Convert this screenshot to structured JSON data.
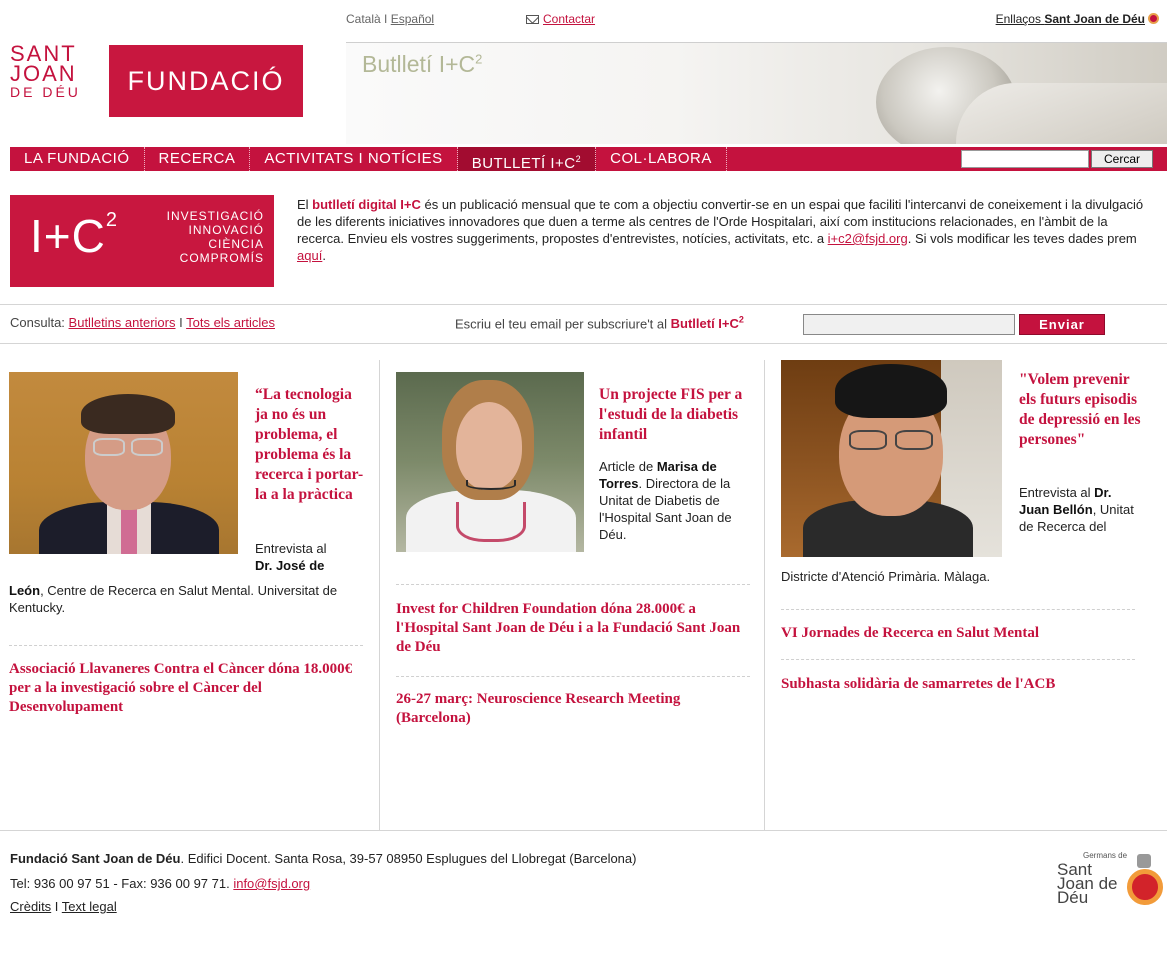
{
  "top": {
    "lang_catala": "Català",
    "lang_sep": "I",
    "lang_espanol": "Español",
    "contact": "Contactar",
    "links_prefix": "Enllaços",
    "links_bold": "Sant Joan de Déu"
  },
  "logo": {
    "line1": "SANT",
    "line2": "JOAN",
    "line3": "DE DÉU",
    "box": "FUNDACIÓ"
  },
  "banner": {
    "title": "Butlletí I+C",
    "title_sup": "2"
  },
  "nav": {
    "items": [
      "LA FUNDACIÓ",
      "RECERCA",
      "ACTIVITATS I NOTÍCIES",
      "BUTLLETÍ I+C",
      "COL·LABORA"
    ],
    "butlleti_sup": "2",
    "search_button": "Cercar",
    "search_value": ""
  },
  "ic_logo": {
    "big": "I+C",
    "sup": "2",
    "words": [
      "INVESTIGACIÓ",
      "INNOVACIÓ",
      "CIÈNCIA",
      "COMPROMÍS"
    ]
  },
  "intro": {
    "t1": "El ",
    "em1": "butlletí digital I+C",
    "t2": " és un publicació mensual que te com a objectiu convertir-se en un espai que faciliti l'intercanvi de coneixement i la divulgació de les diferents iniciatives innovadores que duen a terme als centres de l'Orde Hospitalari, així com institucions relacionades, en l'àmbit de la recerca. Envieu els vostres suggeriments, propostes d'entrevistes, notícies, activitats, etc. a ",
    "email": "i+c2@fsjd.org",
    "t3": ". Si vols modificar les teves dades prem ",
    "here": "aquí",
    "t4": "."
  },
  "subbar": {
    "consulta_label": "Consulta: ",
    "link_previous": "Butlletins anteriors",
    "sep": " I ",
    "link_all": "Tots els articles",
    "subscribe_text": "Escriu el teu email per subscriure't al ",
    "subscribe_bold": "Butlletí I+C",
    "subscribe_sup": "2",
    "input_value": "",
    "send_button": "Enviar"
  },
  "col1": {
    "title": "“La tecnologia ja no és un problema, el problema és la recerca i portar-la a la pràctica",
    "text_a": "Entrevista al",
    "text_b": "Dr. José de",
    "text_c_bold": "León",
    "text_c": ", Centre de Recerca en Salut Mental. Universitat de Kentucky.",
    "news1": "Associació Llavaneres Contra el Càncer dóna 18.000€ per a la investigació sobre el Càncer del Desenvolupament"
  },
  "col2": {
    "title": "Un projecte FIS per a l'estudi de la diabetis infantil",
    "text_a": "Article de ",
    "text_bold": "Marisa de Torres",
    "text_b": ". Directora de la Unitat de Diabetis de l'Hospital Sant Joan de Déu.",
    "news1": "Invest for Children Foundation dóna 28.000€ a l'Hospital Sant Joan de Déu i a la Fundació Sant Joan de Déu",
    "news2": "26-27 març: Neuroscience Research Meeting (Barcelona)"
  },
  "col3": {
    "title": "\"Volem prevenir els futurs episodis de depressió en les persones\"",
    "text_a": "Entrevista al ",
    "text_bold": "Dr. Juan Bellón",
    "text_b": ", Unitat de Recerca del",
    "text_c": "Districte d'Atenció Primària. Màlaga.",
    "news1": "VI Jornades de Recerca en Salut Mental",
    "news2": "Subhasta solidària de samarretes de l'ACB"
  },
  "footer": {
    "org": "Fundació Sant Joan de Déu",
    "address": ". Edifici Docent. Santa Rosa, 39-57 08950 Esplugues del Llobregat (Barcelona)",
    "tel": "Tel: 936 00 97 51 - Fax: 936 00 97 71. ",
    "email": "info@fsjd.org",
    "credits": "Crèdits",
    "sep": " I ",
    "legal": "Text legal",
    "logo_top": "Germans de",
    "logo_text": "Sant Joan de Déu"
  },
  "colors": {
    "accent": "#c4123e",
    "nav_bg": "#c4123e",
    "title_green": "#b3b897"
  }
}
